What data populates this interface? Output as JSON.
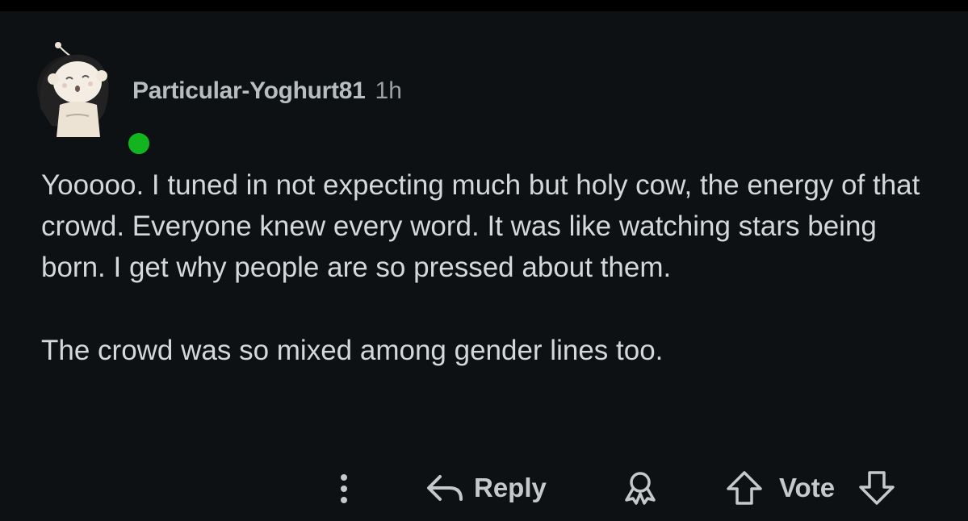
{
  "comment": {
    "username": "Particular-Yoghurt81",
    "age": "1h",
    "paragraphs": [
      "Yooooo. I tuned in not expecting much but holy cow, the energy of that crowd. Everyone knew every word. It was like watching stars being born. I get why people are so pressed about them.",
      "The crowd was so mixed among gender lines too."
    ],
    "online_status_color": "#12b51e"
  },
  "actions": {
    "more_icon": "vertical-ellipsis-icon",
    "reply_label": "Reply",
    "reply_icon": "reply-arrow-icon",
    "award_icon": "award-icon",
    "upvote_icon": "upvote-arrow-icon",
    "vote_label": "Vote",
    "downvote_icon": "downvote-arrow-icon"
  }
}
